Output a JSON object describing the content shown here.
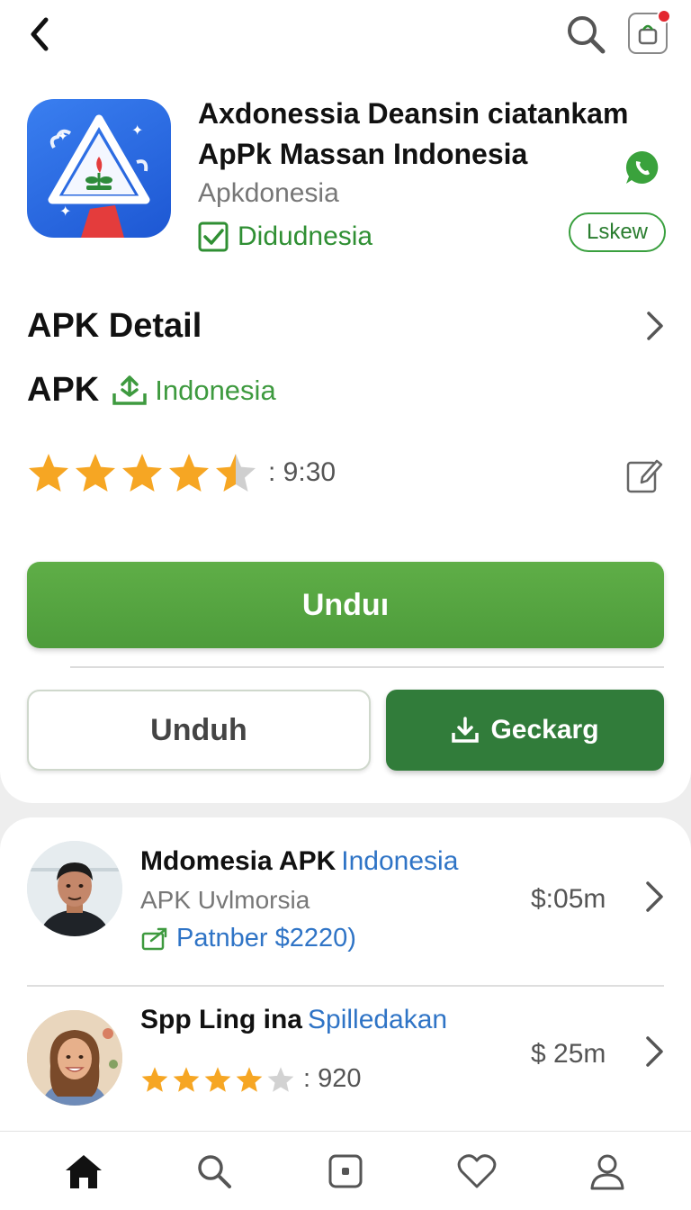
{
  "header": {
    "back_icon": "chevron-left-icon",
    "search_icon": "search-icon",
    "cart_icon": "shopping-bag-icon"
  },
  "app": {
    "title": "Axdonessia Deansin ciatankam ApPk Massan Indonesia",
    "developer": "Apkdonesia",
    "verified_label": "Didudnesia",
    "chat_icon": "whatsapp-icon",
    "lskew_label": "Lskew"
  },
  "detail": {
    "title": "APK Detail",
    "apk_label": "APK",
    "region": "Indonesia",
    "rating": 4.5,
    "rating_time": ": 9:30"
  },
  "actions": {
    "primary_label": "Unduı",
    "secondary_label": "Unduh",
    "tertiary_label": "Geckarg"
  },
  "list": [
    {
      "name": "Mdomesia APK",
      "tag": "Indonesia",
      "subtitle": "APK Uvlmorsia",
      "partner": "Patnber $2220)",
      "price": "$:05m"
    },
    {
      "name": "Spp Ling ina",
      "tag": "Spilledakan",
      "rating": 4,
      "count": ": 920",
      "price": "$ 25m"
    }
  ],
  "nav": [
    "home-icon",
    "search-icon",
    "store-icon",
    "heart-icon",
    "profile-icon"
  ],
  "colors": {
    "accent_green": "#4f9f3d",
    "dark_green": "#317c3a",
    "link_blue": "#2f74c6",
    "star": "#f6a623"
  }
}
